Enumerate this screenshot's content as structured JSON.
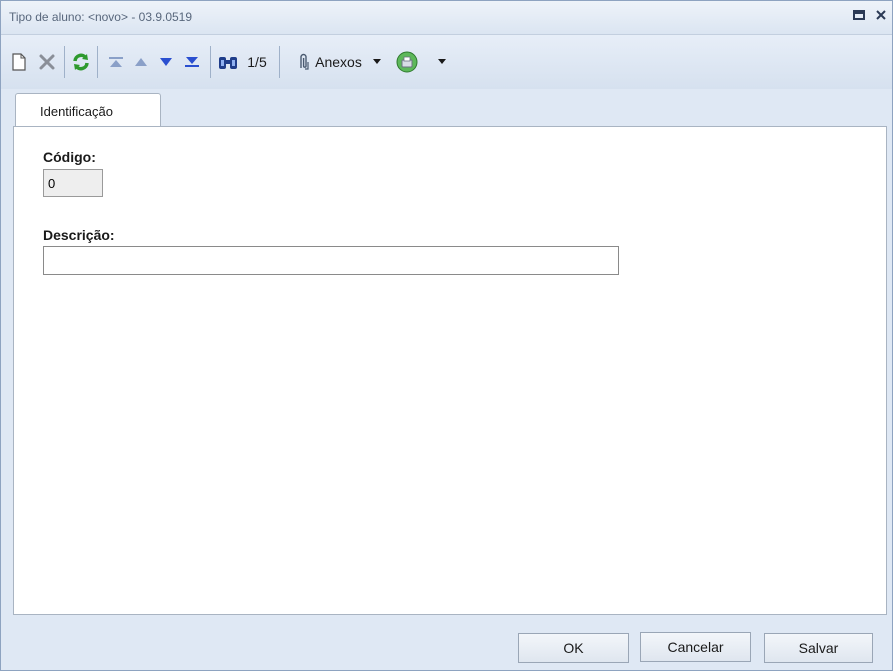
{
  "window": {
    "title": "Tipo de aluno: <novo> - 03.9.0519"
  },
  "toolbar": {
    "record_counter": "1/5",
    "attachments_label": "Anexos",
    "icons": [
      "new-record-icon",
      "delete-icon",
      "refresh-icon",
      "first-record-icon",
      "previous-record-icon",
      "next-record-icon",
      "last-record-icon",
      "find-icon",
      "paperclip-icon",
      "dropdown-arrow-icon",
      "report-icon",
      "dropdown-arrow-icon"
    ]
  },
  "tabs": [
    {
      "label": "Identificação",
      "active": true
    }
  ],
  "form": {
    "codigo_label": "Código:",
    "codigo_value": "0",
    "descricao_label": "Descrição:",
    "descricao_value": ""
  },
  "footer": {
    "ok_label": "OK",
    "cancel_label": "Cancelar",
    "save_label": "Salvar"
  },
  "colors": {
    "window_background": "#dfe8f4",
    "panel_background": "#ffffff",
    "refresh_icon": "#2e9a2e",
    "nav_icon": "#2a4fd0"
  }
}
